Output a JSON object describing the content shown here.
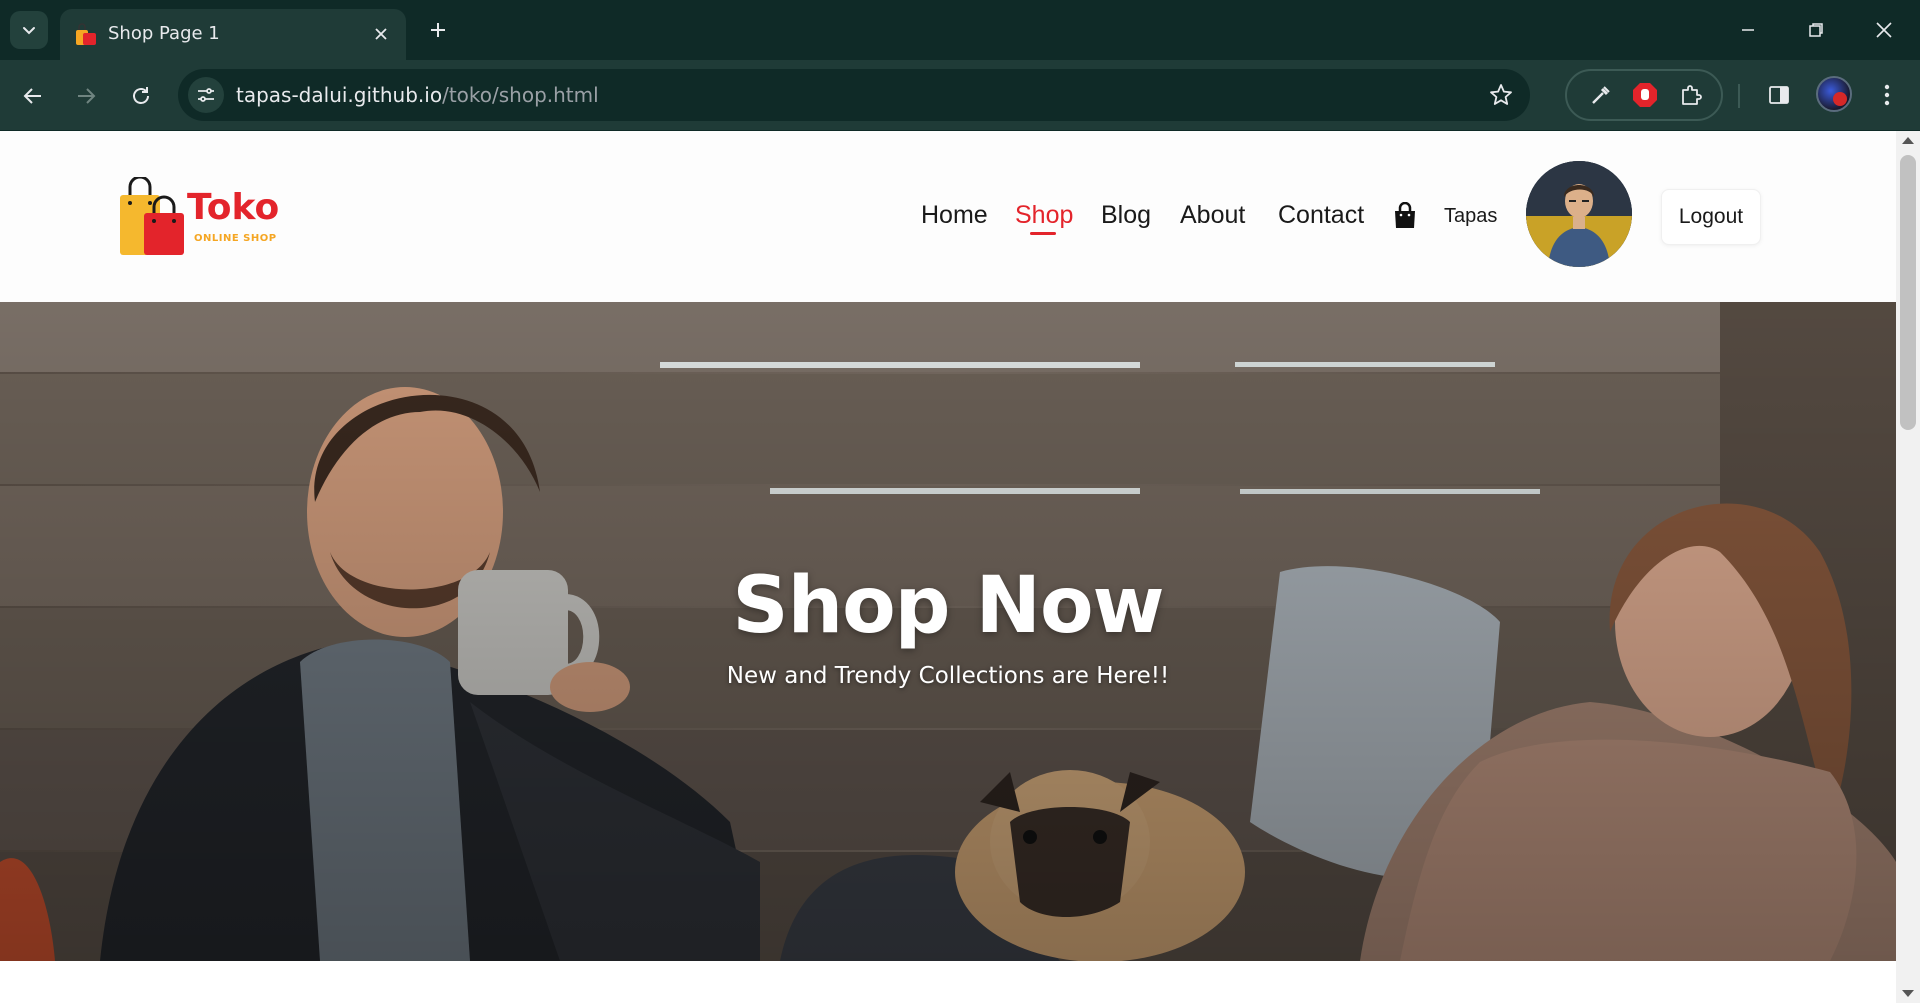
{
  "browser": {
    "tab_title": "Shop Page 1",
    "url_host": "tapas-dalui.github.io",
    "url_path": "/toko/shop.html"
  },
  "site": {
    "logo_name": "Toko",
    "logo_tagline": "ONLINE SHOP",
    "nav": [
      {
        "label": "Home",
        "active": false
      },
      {
        "label": "Shop",
        "active": true
      },
      {
        "label": "Blog",
        "active": false
      },
      {
        "label": "About",
        "active": false
      },
      {
        "label": "Contact",
        "active": false
      }
    ],
    "user_name": "Tapas",
    "logout_label": "Logout",
    "accent_color": "#e3242b",
    "logo_secondary_color": "#f5a623"
  },
  "hero": {
    "title": "Shop Now",
    "subtitle": "New and Trendy Collections are Here!!"
  },
  "icons": {
    "tab_search": "chevron-down-icon",
    "back": "arrow-left-icon",
    "forward": "arrow-right-icon",
    "reload": "reload-icon",
    "site_info": "tune-icon",
    "bookmark": "star-icon",
    "cart": "shopping-bag-icon"
  }
}
